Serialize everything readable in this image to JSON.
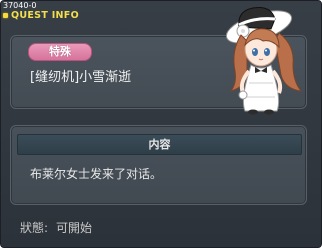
{
  "window": {
    "quest_id": "37040-0",
    "title": "QUEST INFO"
  },
  "info": {
    "category": "特殊",
    "quest_name": "[缝纫机]小雪渐逝"
  },
  "content": {
    "header": "内容",
    "text": "布莱尔女士发来了对话。"
  },
  "status": {
    "label": "狀態:",
    "value": "可開始"
  },
  "npc": {
    "icon": "npc-lady-portrait"
  },
  "colors": {
    "title_accent": "#f3de4d",
    "badge_pink": "#e1859f",
    "panel_bg": "#48515a",
    "window_bg": "#353b42"
  }
}
